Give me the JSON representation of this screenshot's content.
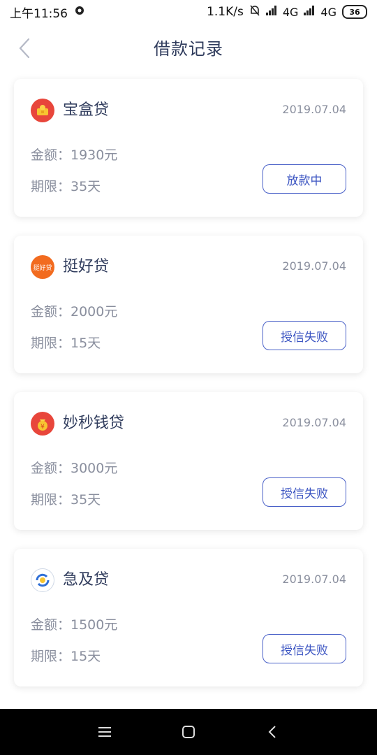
{
  "status_bar": {
    "time": "上午11:56",
    "speed": "1.1K/s",
    "signal1": "4G",
    "signal2": "4G",
    "battery": "36"
  },
  "header": {
    "title": "借款记录"
  },
  "loans": [
    {
      "name": "宝盒贷",
      "date": "2019.07.04",
      "amount": "金额：1930元",
      "term": "期限：35天",
      "status": "放款中",
      "logo_color": "#e8463b",
      "logo_icon": "gold-box-icon"
    },
    {
      "name": "挺好贷",
      "date": "2019.07.04",
      "amount": "金额：2000元",
      "term": "期限：15天",
      "status": "授信失败",
      "logo_color": "#f26b1f",
      "logo_icon": "tinghaodai-logo",
      "logo_text": "挺好贷"
    },
    {
      "name": "妙秒钱贷",
      "date": "2019.07.04",
      "amount": "金额：3000元",
      "term": "期限：35天",
      "status": "授信失败",
      "logo_color": "#e8463b",
      "logo_icon": "money-bag-icon"
    },
    {
      "name": "急及贷",
      "date": "2019.07.04",
      "amount": "金额：1500元",
      "term": "期限：15天",
      "status": "授信失败",
      "logo_color": "#2f6fd6",
      "logo_icon": "refresh-coin-icon"
    }
  ],
  "colors": {
    "accent": "#3c55c2",
    "text_dark": "#2f3b5c",
    "text_gray": "#8a8f9e"
  }
}
